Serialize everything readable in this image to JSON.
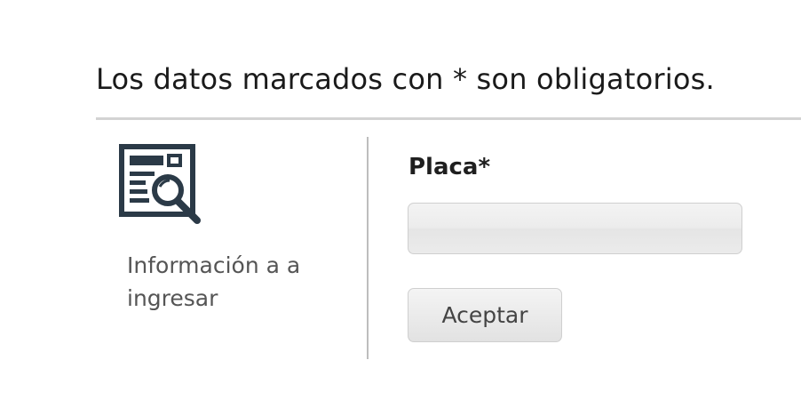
{
  "notice": "Los datos marcados con * son obligatorios.",
  "section": {
    "icon": "document-search-icon",
    "description": "Información a a ingresar"
  },
  "form": {
    "plate_label": "Placa*",
    "plate_value": "",
    "plate_placeholder": "",
    "submit_label": "Aceptar"
  },
  "colors": {
    "icon": "#2b3a47",
    "rule": "#d3d3d3",
    "divider": "#bdbdbd"
  }
}
